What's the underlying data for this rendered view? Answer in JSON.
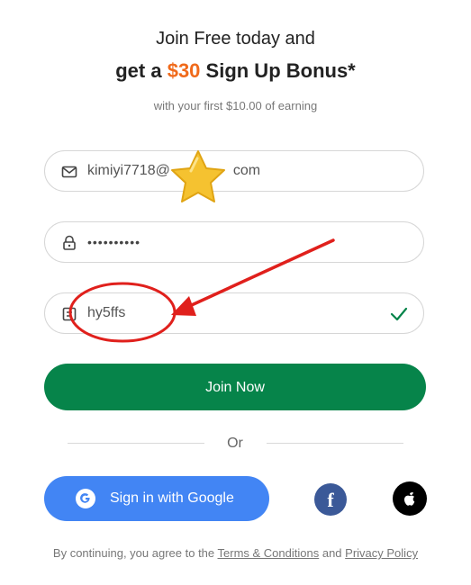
{
  "header": {
    "line1": "Join Free today and",
    "line2_prefix": "get a ",
    "line2_amount": "$30",
    "line2_suffix": " Sign Up Bonus*",
    "subtext": "with your first $10.00 of earning"
  },
  "form": {
    "email_value": "kimiyi7718@",
    "email_value_tail": "com",
    "password_value": "••••••••••",
    "code_value": "hy5ffs"
  },
  "buttons": {
    "join": "Join Now",
    "google": "Sign in with Google"
  },
  "divider": {
    "or": "Or"
  },
  "footer": {
    "prefix": "By continuing, you agree to the ",
    "terms": "Terms & Conditions",
    "and": " and ",
    "privacy": "Privacy Policy"
  },
  "colors": {
    "accent_orange": "#f06a1b",
    "primary_green": "#06844a",
    "google_blue": "#4285f4",
    "facebook_blue": "#3b5998",
    "annotation_red": "#e0201c"
  },
  "icons": [
    "mail-icon",
    "lock-icon",
    "code-icon",
    "check-icon",
    "google-icon",
    "facebook-icon",
    "apple-icon",
    "star-sticker"
  ]
}
